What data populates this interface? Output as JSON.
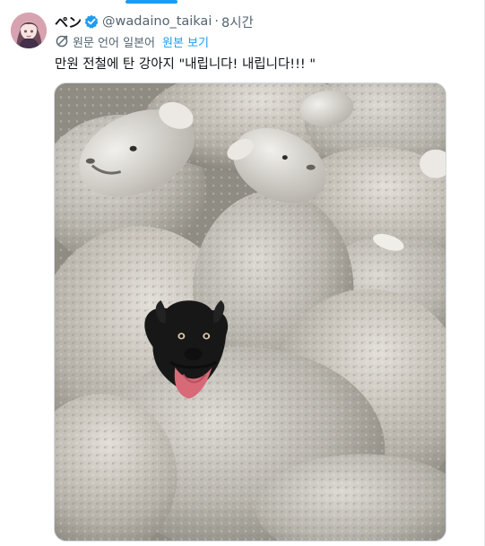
{
  "ui": {
    "accent": "#1d9bf0",
    "text_primary": "#0f1419",
    "text_secondary": "#536471",
    "icons": [
      "verified-badge-icon",
      "translate-icon"
    ]
  },
  "tweet": {
    "author": {
      "display_name": "ペン",
      "handle": "@wadaino_taikai"
    },
    "separator": "·",
    "time": "8시간",
    "translation": {
      "label": "원문 언어 일본어",
      "link": "원본 보기"
    },
    "text": "만원 전철에 탄 강아지 \"내립니다! 내립니다!!! \"",
    "media": {
      "kind": "photo"
    }
  }
}
